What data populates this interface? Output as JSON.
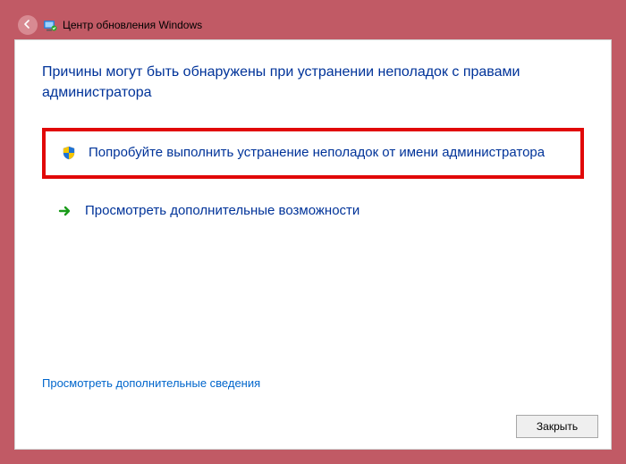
{
  "window": {
    "title": "Центр обновления Windows"
  },
  "content": {
    "heading": "Причины могут быть обнаружены при устранении неполадок с правами администратора",
    "option_admin": "Попробуйте выполнить устранение неполадок от имени администратора",
    "option_more": "Просмотреть дополнительные возможности",
    "link_details": "Просмотреть дополнительные сведения"
  },
  "buttons": {
    "close": "Закрыть"
  },
  "icons": {
    "back": "back-arrow-icon",
    "shield": "uac-shield-icon",
    "arrow": "green-arrow-icon",
    "app": "troubleshoot-icon"
  }
}
